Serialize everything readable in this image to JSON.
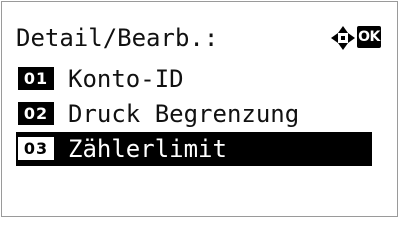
{
  "header": {
    "title": "Detail/Bearb.:",
    "nav_icon": "four-way-arrow-icon",
    "ok_label": "OK"
  },
  "menu": {
    "items": [
      {
        "number": "01",
        "label": "Konto-ID",
        "selected": false
      },
      {
        "number": "02",
        "label": "Druck Begrenzung",
        "selected": false
      },
      {
        "number": "03",
        "label": "Zählerlimit",
        "selected": true
      }
    ]
  },
  "colors": {
    "background": "#ffffff",
    "text": "#111111",
    "highlight": "#000000",
    "highlight_text": "#ffffff"
  }
}
